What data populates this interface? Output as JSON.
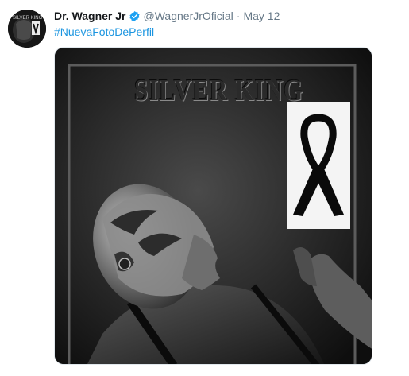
{
  "tweet": {
    "display_name": "Dr. Wagner Jr",
    "handle": "@WagnerJrOficial",
    "separator": "·",
    "date": "May 12",
    "hashtag": "#NuevaFotoDePerfil",
    "verified_color": "#1da1f2",
    "link_color": "#1b95e0"
  },
  "media": {
    "photo_text": "SILVER KING",
    "ribbon_icon": "black-mourning-ribbon-icon"
  }
}
